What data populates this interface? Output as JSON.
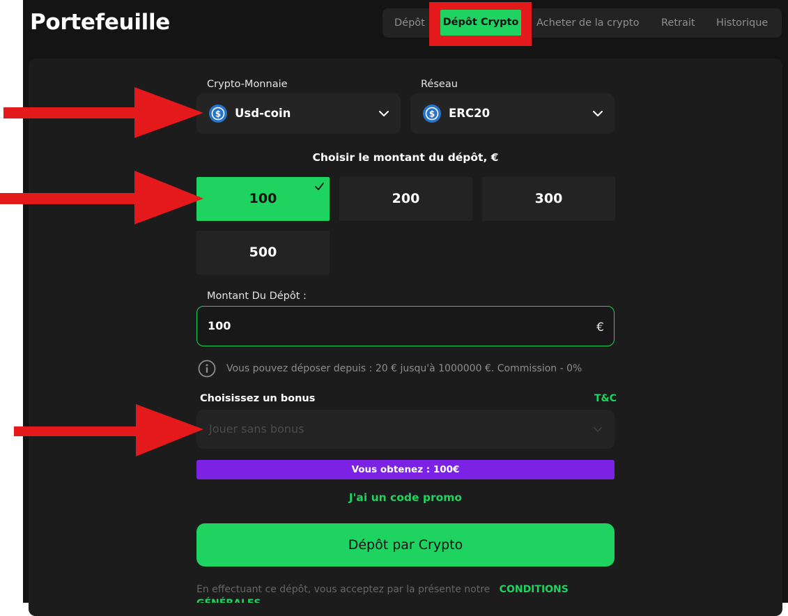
{
  "page": {
    "title": "Portefeuille"
  },
  "tabs": [
    {
      "label": "Dépôt"
    },
    {
      "label": "Dépôt Crypto",
      "active": true
    },
    {
      "label": "Acheter de la crypto"
    },
    {
      "label": "Retrait"
    },
    {
      "label": "Historique"
    }
  ],
  "crypto": {
    "label": "Crypto-Monnaie",
    "value": "Usd-coin",
    "icon": "usdc-coin-icon"
  },
  "network": {
    "label": "Réseau",
    "value": "ERC20",
    "icon": "usdc-coin-icon"
  },
  "amounts": {
    "title": "Choisir le montant du dépôt, €",
    "options": [
      "100",
      "200",
      "300",
      "500"
    ],
    "selected": "100"
  },
  "deposit_field": {
    "label": "Montant Du Dépôt :",
    "value": "100",
    "currency": "€"
  },
  "info": {
    "text": "Vous pouvez déposer depuis : 20 € jusqu'à 1000000 €. Commission - 0%"
  },
  "bonus": {
    "label": "Choisissez un bonus",
    "tc_link": "T&C",
    "placeholder": "Jouer sans bonus",
    "obtain_text": "Vous obtenez : 100€"
  },
  "promo_link": "J'ai un code promo",
  "submit_label": "Dépôt par Crypto",
  "terms": {
    "text": "En effectuant ce dépôt, vous acceptez par la présente notre",
    "link": "CONDITIONS GÉNÉRALES"
  },
  "colors": {
    "accent": "#1ed35f",
    "bonus_bar": "#7b22e4",
    "annotation": "#e4191b",
    "background": "#141414"
  }
}
